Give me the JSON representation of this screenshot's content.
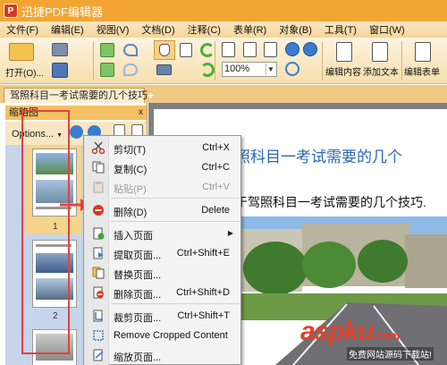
{
  "app": {
    "title": "迅捷PDF编辑器",
    "logo_letter": "P"
  },
  "menu": [
    "文件(F)",
    "编辑(E)",
    "视图(V)",
    "文档(D)",
    "注释(C)",
    "表单(R)",
    "对象(B)",
    "工具(T)",
    "窗口(W)"
  ],
  "toolbar": {
    "open_label": "打开(O)...",
    "zoom_value": "100%",
    "edit_content_label": "编辑内容",
    "add_text_label": "添加文本",
    "edit_form_label": "编辑表单"
  },
  "tabs": [
    {
      "label": "驾照科目一考试需要的几个技巧"
    }
  ],
  "new_tab": "+",
  "panel": {
    "title": "缩略图",
    "close": "x",
    "options": "Options...",
    "pages": [
      "1",
      "2"
    ]
  },
  "document": {
    "heading": "照科目一考试需要的几个",
    "subtext": "于驾照科目一考试需要的几个技巧."
  },
  "context_menu": {
    "items": [
      {
        "label": "剪切(T)",
        "shortcut": "Ctrl+X",
        "icon": "scissors-icon",
        "disabled": false
      },
      {
        "label": "复制(C)",
        "shortcut": "Ctrl+C",
        "icon": "copy-icon",
        "disabled": false
      },
      {
        "label": "粘贴(P)",
        "shortcut": "Ctrl+V",
        "icon": "paste-icon",
        "disabled": true
      },
      {
        "label": "删除(D)",
        "shortcut": "Delete",
        "icon": "delete-icon",
        "disabled": false
      },
      {
        "label": "插入页面",
        "shortcut": "",
        "icon": "insert-page-icon",
        "disabled": false,
        "submenu": true
      },
      {
        "label": "提取页面...",
        "shortcut": "Ctrl+Shift+E",
        "icon": "extract-page-icon",
        "disabled": false
      },
      {
        "label": "替换页面...",
        "shortcut": "",
        "icon": "replace-page-icon",
        "disabled": false
      },
      {
        "label": "删除页面...",
        "shortcut": "Ctrl+Shift+D",
        "icon": "delete-page-icon",
        "disabled": false
      },
      {
        "label": "裁剪页面...",
        "shortcut": "Ctrl+Shift+T",
        "icon": "crop-page-icon",
        "disabled": false
      },
      {
        "label": "Remove Cropped Content",
        "shortcut": "",
        "icon": "remove-crop-icon",
        "disabled": false
      },
      {
        "label": "缩放页面...",
        "shortcut": "",
        "icon": "resize-page-icon",
        "disabled": false
      }
    ]
  },
  "watermark": {
    "brand": "aspku",
    "suffix": ".com",
    "sub": "免费网站源码下载站!"
  },
  "colors": {
    "title_bar": "#f2a533",
    "heading_blue": "#2a67b1",
    "annotation_red": "#e8403a",
    "thumbnail_bg": "#c6d5ea"
  }
}
